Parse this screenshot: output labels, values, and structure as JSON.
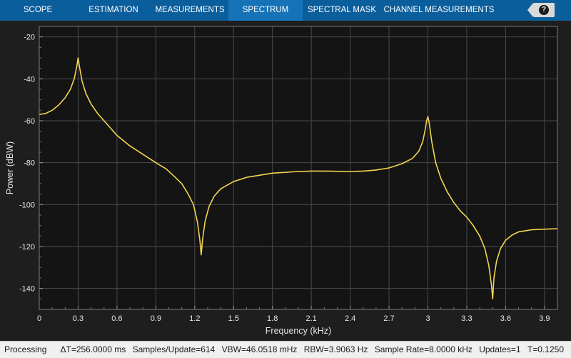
{
  "toolbar": {
    "tabs": [
      {
        "label": "SCOPE",
        "active": false
      },
      {
        "label": "ESTIMATION",
        "active": false
      },
      {
        "label": "MEASUREMENTS",
        "active": false
      },
      {
        "label": "SPECTRUM",
        "active": true
      },
      {
        "label": "SPECTRAL MASK",
        "active": false
      },
      {
        "label": "CHANNEL MEASUREMENTS",
        "active": false
      }
    ],
    "help_label": "?"
  },
  "colors": {
    "toolbar_bg": "#0b5e9c",
    "active_tab": "#1673b8",
    "plot_bg": "#141414",
    "grid": "#4a4a4a",
    "trace": "#f2d54e",
    "tick_text": "#e6e6e6"
  },
  "chart_data": {
    "type": "line",
    "xlabel": "Frequency (kHz)",
    "ylabel": "Power (dBW)",
    "xlim": [
      0,
      4.0
    ],
    "ylim": [
      -150,
      -15
    ],
    "xticks": [
      0,
      0.3,
      0.6,
      0.9,
      1.2,
      1.5,
      1.8,
      2.1,
      2.4,
      2.7,
      3.0,
      3.3,
      3.6,
      3.9
    ],
    "xtick_labels": [
      "0",
      "0.3",
      "0.6",
      "0.9",
      "1.2",
      "1.5",
      "1.8",
      "2.1",
      "2.4",
      "2.7",
      "3",
      "3.3",
      "3.6",
      "3.9"
    ],
    "yticks": [
      -20,
      -40,
      -60,
      -80,
      -100,
      -120,
      -140
    ],
    "ytick_labels": [
      "-20",
      "-40",
      "-60",
      "-80",
      "-100",
      "-120",
      "-140"
    ],
    "grid": true,
    "series": [
      {
        "x": [
          0,
          0.05,
          0.1,
          0.15,
          0.2,
          0.24,
          0.27,
          0.29,
          0.3,
          0.31,
          0.33,
          0.36,
          0.4,
          0.45,
          0.5,
          0.6,
          0.7,
          0.8,
          0.9,
          0.98,
          1.05,
          1.1,
          1.15,
          1.19,
          1.22,
          1.24,
          1.25,
          1.26,
          1.28,
          1.31,
          1.35,
          1.4,
          1.5,
          1.6,
          1.8,
          2.0,
          2.1,
          2.2,
          2.4,
          2.5,
          2.6,
          2.7,
          2.8,
          2.88,
          2.93,
          2.96,
          2.98,
          2.99,
          3.0,
          3.01,
          3.03,
          3.06,
          3.1,
          3.15,
          3.2,
          3.25,
          3.3,
          3.35,
          3.4,
          3.44,
          3.47,
          3.49,
          3.5,
          3.51,
          3.53,
          3.56,
          3.6,
          3.65,
          3.7,
          3.8,
          3.9,
          4.0
        ],
        "y": [
          -57,
          -56.5,
          -55,
          -52.5,
          -49,
          -45,
          -40,
          -34,
          -30,
          -34,
          -41,
          -47,
          -52,
          -56.5,
          -60,
          -67,
          -72,
          -76,
          -80,
          -83,
          -87,
          -90,
          -95,
          -100,
          -108,
          -117,
          -124,
          -117,
          -108,
          -101,
          -96,
          -92.5,
          -89,
          -87,
          -85,
          -84.2,
          -84,
          -84,
          -84.2,
          -84,
          -83.5,
          -82.5,
          -80.5,
          -78,
          -74.5,
          -70,
          -64,
          -60,
          -58,
          -61,
          -70,
          -80,
          -87.5,
          -94,
          -99,
          -103,
          -106,
          -110,
          -115,
          -121,
          -129,
          -138,
          -145,
          -135,
          -127,
          -121,
          -117,
          -114.5,
          -113,
          -112,
          -111.7,
          -111.5
        ]
      }
    ]
  },
  "status": {
    "left": "Processing",
    "items": [
      "ΔT=256.0000 ms",
      "Samples/Update=614",
      "VBW=46.0518 mHz",
      "RBW=3.9063 Hz",
      "Sample Rate=8.0000 kHz",
      "Updates=1",
      "T=0.1250"
    ]
  }
}
